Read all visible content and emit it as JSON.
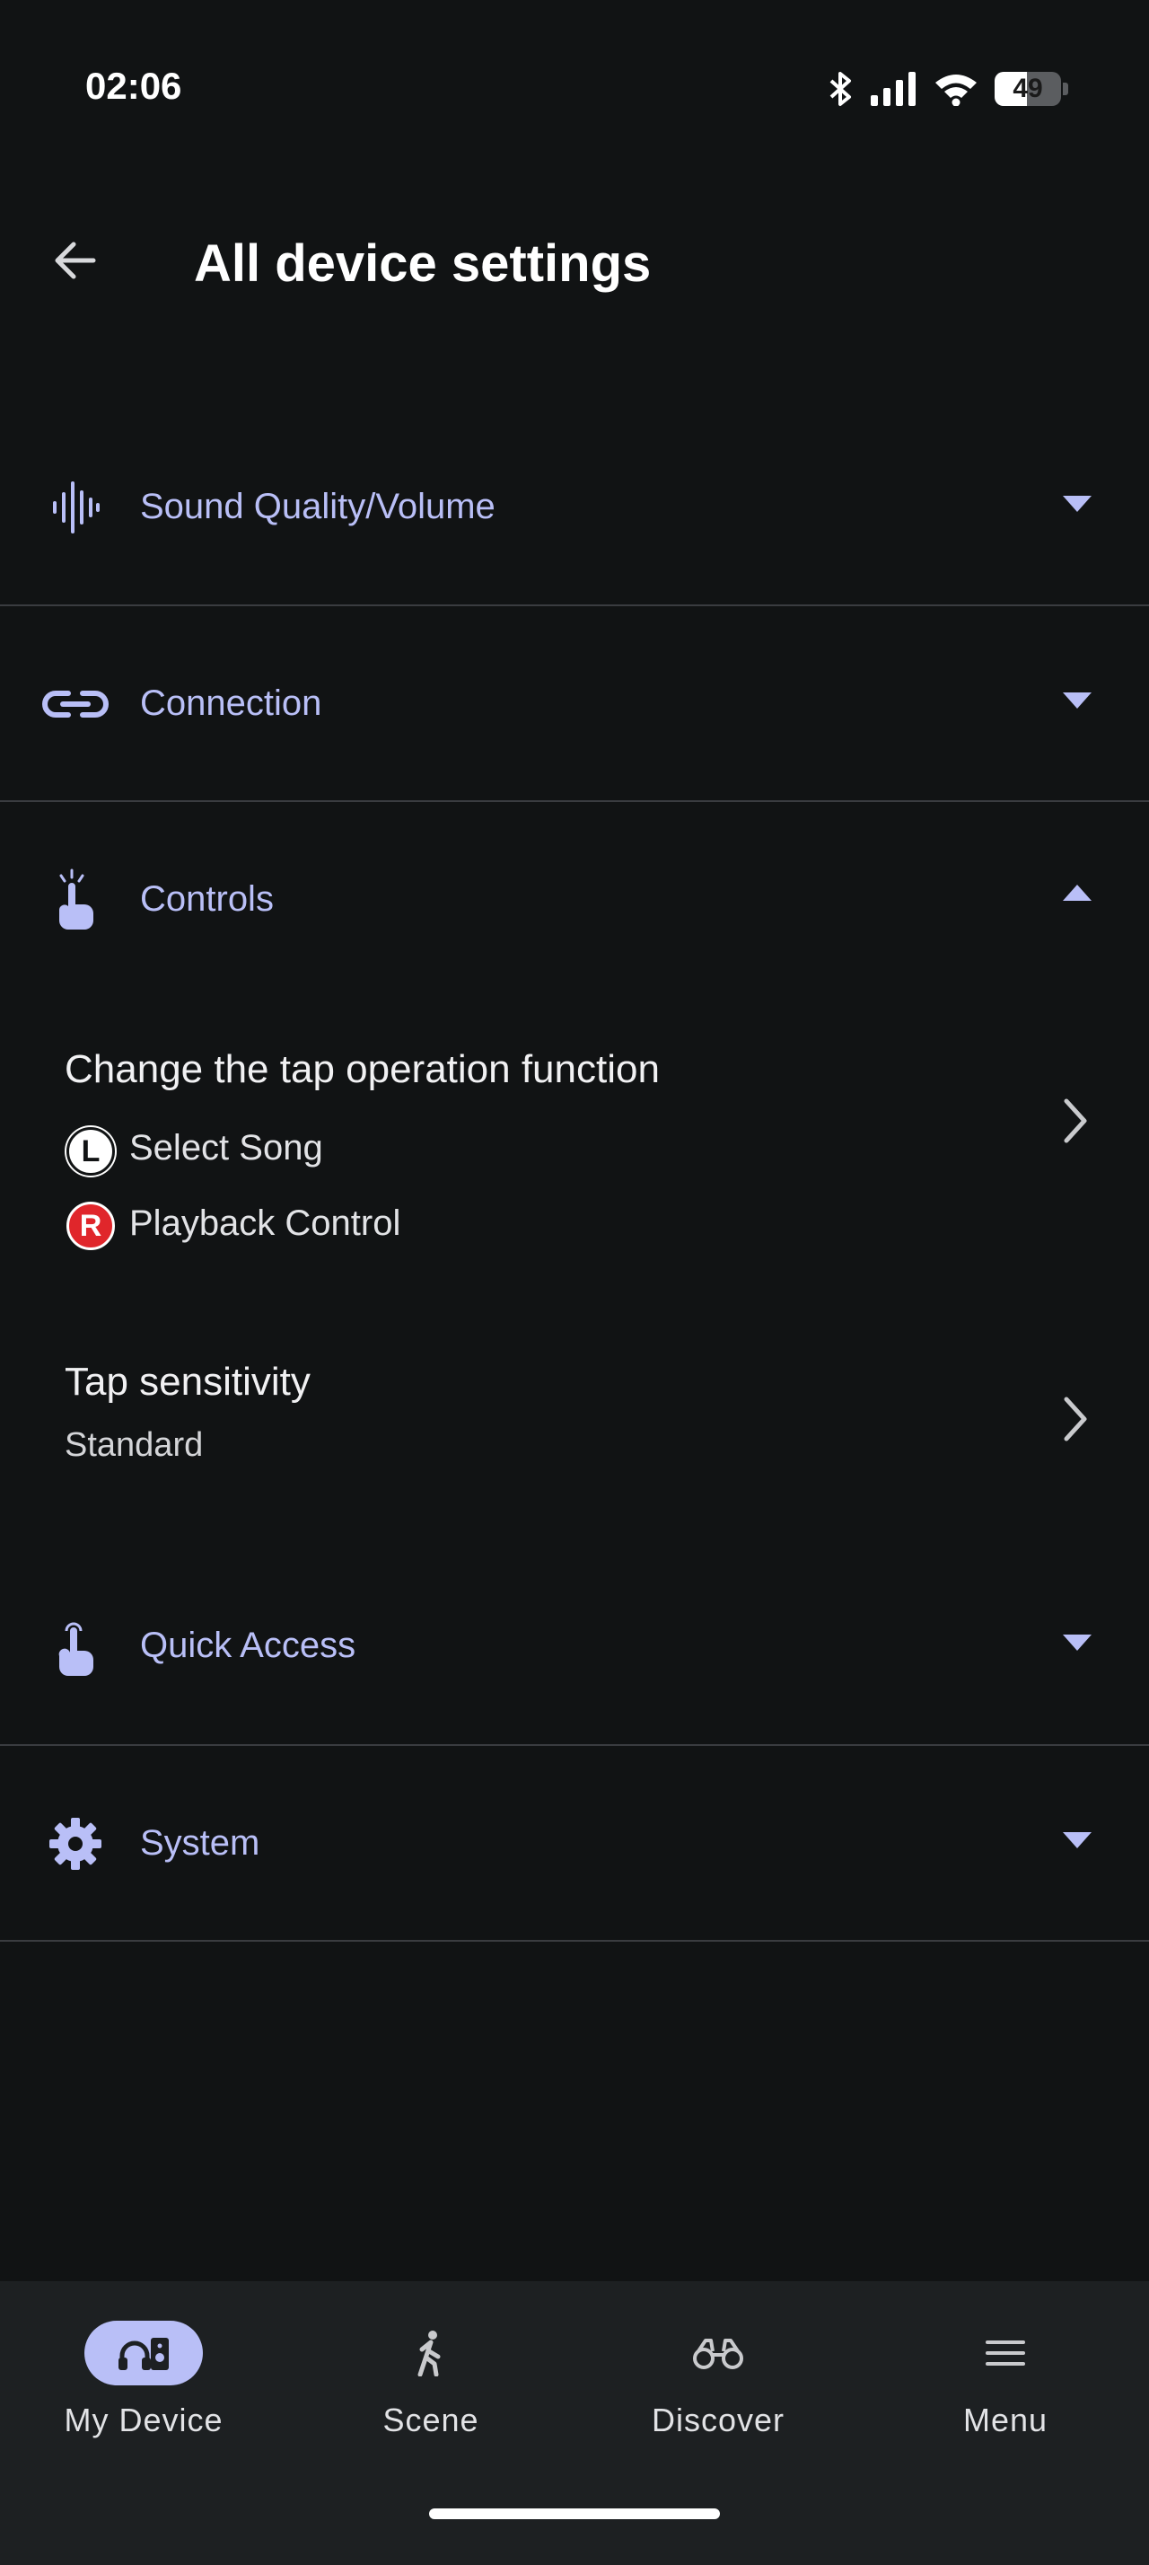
{
  "status_bar": {
    "time": "02:06",
    "battery_level": "49",
    "battery_fraction": 0.49,
    "icons": [
      "bluetooth-icon",
      "signal-icon",
      "wifi-icon",
      "battery-icon"
    ]
  },
  "header": {
    "title": "All device settings",
    "back_icon": "arrow-left-icon"
  },
  "sections": [
    {
      "label": "Sound Quality/Volume",
      "icon": "sound-wave-icon",
      "expanded": false
    },
    {
      "label": "Connection",
      "icon": "link-icon",
      "expanded": false
    },
    {
      "label": "Controls",
      "icon": "touch-icon",
      "expanded": true
    },
    {
      "label": "Quick Access",
      "icon": "hand-touch-icon",
      "expanded": false
    },
    {
      "label": "System",
      "icon": "gear-icon",
      "expanded": false
    }
  ],
  "controls": {
    "tap_function": {
      "title": "Change the tap operation function",
      "left_badge": "L",
      "left_value": "Select Song",
      "right_badge": "R",
      "right_value": "Playback Control"
    },
    "tap_sensitivity": {
      "title": "Tap sensitivity",
      "value": "Standard"
    }
  },
  "bottom_nav": {
    "items": [
      {
        "label": "My Device",
        "icon": "device-icon",
        "active": true
      },
      {
        "label": "Scene",
        "icon": "walking-person-icon",
        "active": false
      },
      {
        "label": "Discover",
        "icon": "binoculars-icon",
        "active": false
      },
      {
        "label": "Menu",
        "icon": "hamburger-menu-icon",
        "active": false
      }
    ]
  },
  "colors": {
    "background": "#111314",
    "accent": "#b9bff7",
    "right_badge": "#e0262b",
    "nav_background": "#1d2022"
  }
}
